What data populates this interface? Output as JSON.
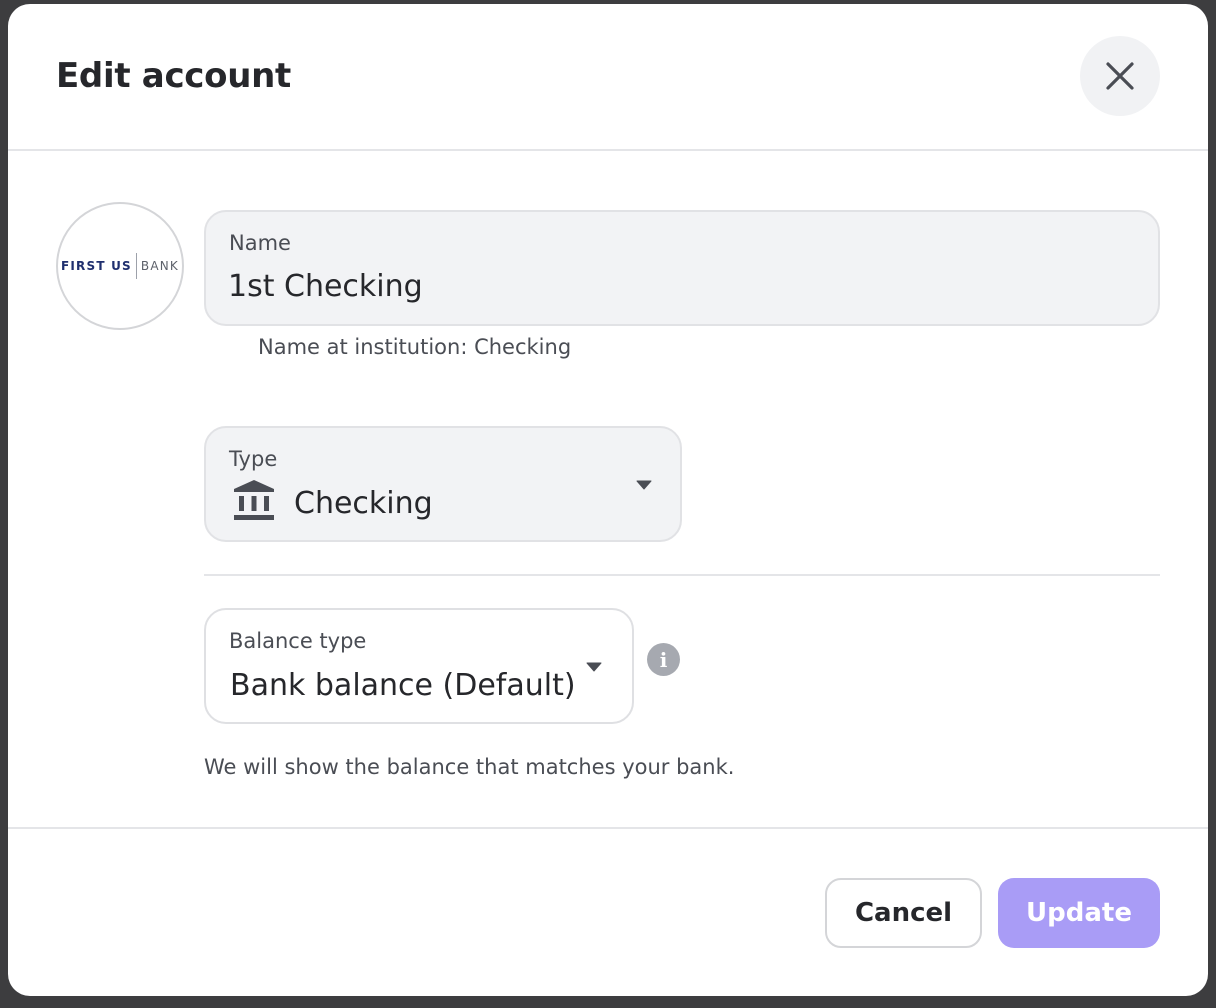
{
  "dialog": {
    "title": "Edit account",
    "close_icon": "close-icon"
  },
  "institution": {
    "logo_left": "FIRST US",
    "logo_right": "BANK"
  },
  "name_field": {
    "label": "Name",
    "value": "1st Checking",
    "helper": "Name at institution: Checking"
  },
  "type_field": {
    "label": "Type",
    "value": "Checking",
    "icon": "bank-icon"
  },
  "balance_type_field": {
    "label": "Balance type",
    "value": "Bank balance (Default)",
    "info_icon": "info-icon",
    "info_glyph": "i",
    "description": "We will show the balance that matches your bank."
  },
  "footer": {
    "cancel_label": "Cancel",
    "update_label": "Update"
  },
  "colors": {
    "accent_disabled": "#a99cf6",
    "field_background": "#f2f3f5",
    "text": "#26272b"
  }
}
